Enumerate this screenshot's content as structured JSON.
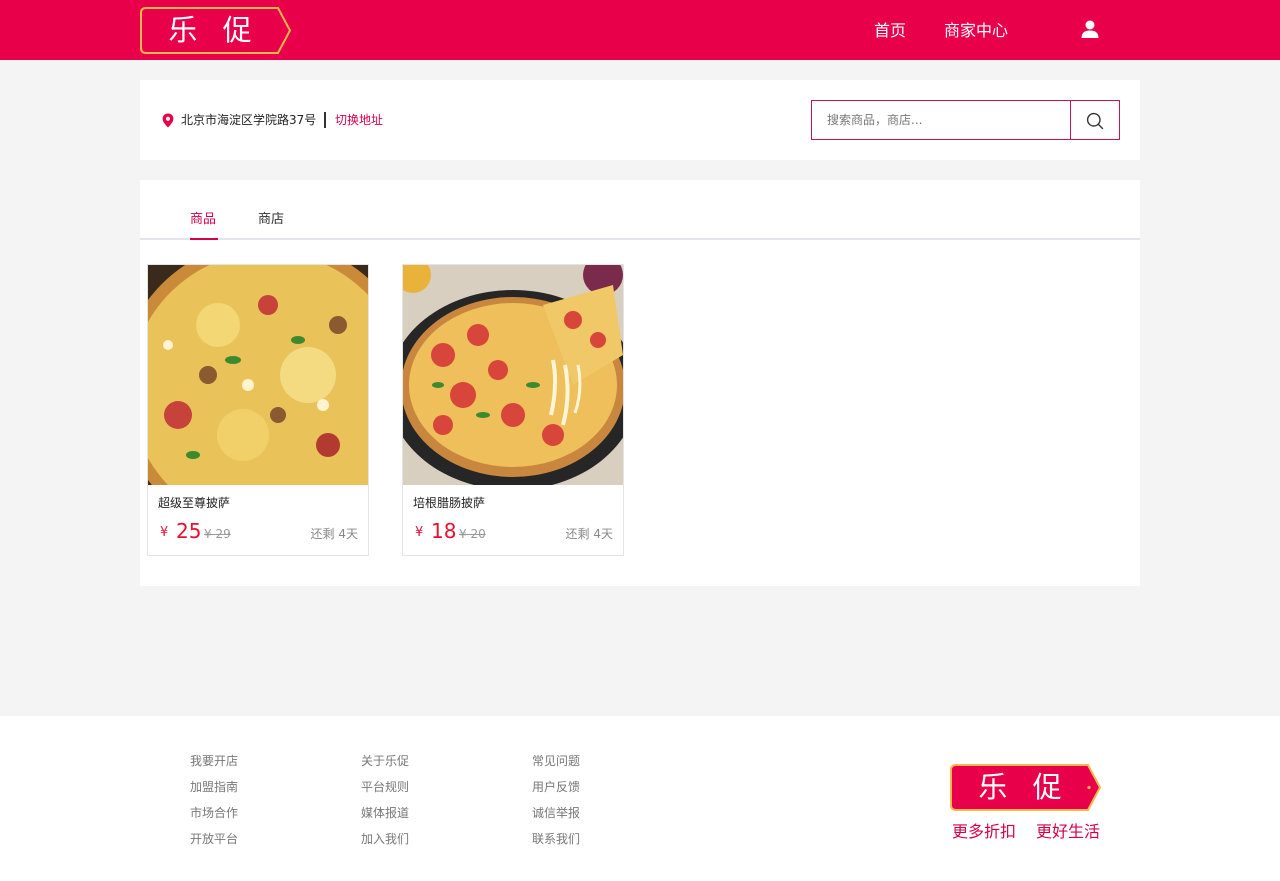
{
  "brand": {
    "name": "乐 促",
    "color": "#e8004a",
    "logo_border": "#f5b84a"
  },
  "header": {
    "nav": [
      {
        "label": "首页"
      },
      {
        "label": "商家中心"
      }
    ],
    "user_icon": "user-icon"
  },
  "location": {
    "icon": "map-pin-icon",
    "address": "北京市海淀区学院路37号",
    "switch_label": "切换地址"
  },
  "search": {
    "placeholder": "搜索商品，商店...",
    "button_icon": "search-icon"
  },
  "tabs": [
    {
      "label": "商品",
      "active": true
    },
    {
      "label": "商店",
      "active": false
    }
  ],
  "products": [
    {
      "name": "超级至尊披萨",
      "currency": "¥",
      "price": "25",
      "old_price": "¥ 29",
      "remaining": "还剩 4天",
      "image": "pizza-photo"
    },
    {
      "name": "培根腊肠披萨",
      "currency": "¥",
      "price": "18",
      "old_price": "¥ 20",
      "remaining": "还剩 4天",
      "image": "pizza-photo"
    }
  ],
  "footer": {
    "columns": [
      [
        "我要开店",
        "加盟指南",
        "市场合作",
        "开放平台"
      ],
      [
        "关于乐促",
        "平台规则",
        "媒体报道",
        "加入我们"
      ],
      [
        "常见问题",
        "用户反馈",
        "诚信举报",
        "联系我们"
      ]
    ],
    "slogans": [
      "更多折扣",
      "更好生活"
    ]
  }
}
